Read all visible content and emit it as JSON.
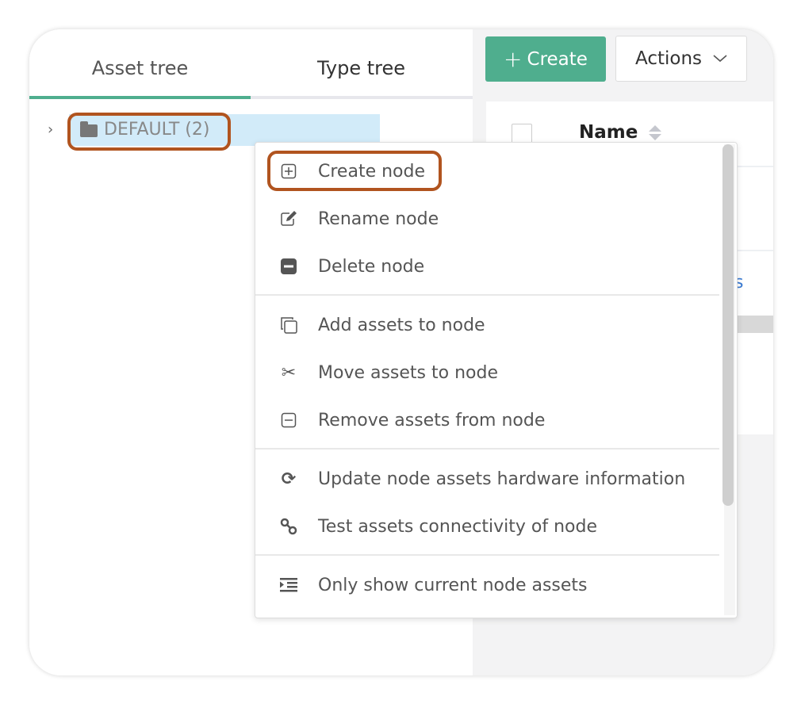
{
  "tabs": [
    {
      "label": "Asset tree",
      "active": true
    },
    {
      "label": "Type tree",
      "active": false
    }
  ],
  "tree": {
    "root": {
      "label": "DEFAULT (2)",
      "icon": "folder-icon",
      "expanded": false
    }
  },
  "toolbar": {
    "create_label": "Create",
    "actions_label": "Actions"
  },
  "table": {
    "columns": [
      {
        "label": "Name",
        "sortable": true
      }
    ],
    "partial_link": "ys"
  },
  "context_menu": {
    "groups": [
      [
        {
          "label": "Create node",
          "icon": "plus-square-icon"
        },
        {
          "label": "Rename node",
          "icon": "edit-icon"
        },
        {
          "label": "Delete node",
          "icon": "minus-square-filled-icon"
        }
      ],
      [
        {
          "label": "Add assets to node",
          "icon": "copy-icon"
        },
        {
          "label": "Move assets to node",
          "icon": "scissors-icon"
        },
        {
          "label": "Remove assets from node",
          "icon": "minus-square-icon"
        }
      ],
      [
        {
          "label": "Update node assets hardware information",
          "icon": "refresh-icon"
        },
        {
          "label": "Test assets connectivity of node",
          "icon": "link-icon"
        }
      ],
      [
        {
          "label": "Only show current node assets",
          "icon": "indent-icon"
        }
      ]
    ]
  },
  "colors": {
    "accent": "#4fae8e",
    "highlight": "#b1541f",
    "selected_row": "#d2ebf9",
    "link": "#3b7bd3"
  }
}
